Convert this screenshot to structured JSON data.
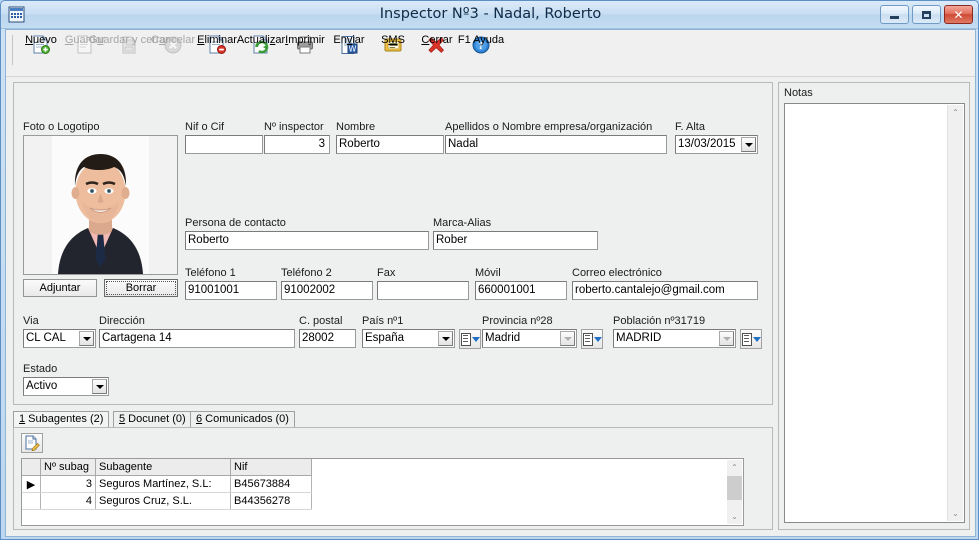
{
  "window": {
    "title": "Inspector Nº3 - Nadal, Roberto",
    "icon": "application-icon",
    "minimize": "minimize-button",
    "maximize": "maximize-button",
    "close": "close-button"
  },
  "toolbar": {
    "items": [
      {
        "label": "Nuevo",
        "accel": "N",
        "icon": "new-document-icon",
        "disabled": false
      },
      {
        "label": "Guardar",
        "accel": "G",
        "icon": "save-document-icon",
        "disabled": true
      },
      {
        "label": "Guardar y cerrar",
        "accel": "u",
        "icon": "save-and-close-icon",
        "disabled": true
      },
      {
        "label": "Cancelar",
        "accel": "a",
        "icon": "cancel-icon",
        "disabled": true
      },
      {
        "label": "Eliminar",
        "accel": "E",
        "icon": "delete-document-icon",
        "disabled": false
      },
      {
        "label": "Actualizar",
        "accel": "z",
        "icon": "refresh-icon",
        "disabled": false
      },
      {
        "label": "Imprimir",
        "accel": "I",
        "icon": "printer-icon",
        "disabled": false
      },
      {
        "label": "Enviar",
        "accel": "v",
        "icon": "send-word-icon",
        "disabled": false
      },
      {
        "label": "SMS",
        "accel": "M",
        "icon": "sms-icon",
        "disabled": false
      },
      {
        "label": "Cerrar",
        "accel": "C",
        "icon": "close-cross-icon",
        "disabled": false
      },
      {
        "label": "F1 Ayuda",
        "accel": "",
        "icon": "help-icon",
        "disabled": false
      }
    ]
  },
  "form": {
    "photo_label": "Foto o Logotipo",
    "attach_button": "Adjuntar",
    "delete_button": "Borrar",
    "nif_label": "Nif o Cif",
    "nif_value": "",
    "inspector_num_label": "Nº inspector",
    "inspector_num_value": "3",
    "nombre_label": "Nombre",
    "nombre_value": "Roberto",
    "apellidos_label": "Apellidos o Nombre empresa/organización",
    "apellidos_value": "Nadal",
    "falta_label": "F. Alta",
    "falta_value": "13/03/2015",
    "contacto_label": "Persona de contacto",
    "contacto_value": "Roberto",
    "marca_label": "Marca-Alias",
    "marca_value": "Rober",
    "tel1_label": "Teléfono 1",
    "tel1_value": "91001001",
    "tel2_label": "Teléfono 2",
    "tel2_value": "91002002",
    "fax_label": "Fax",
    "fax_value": "",
    "movil_label": "Móvil",
    "movil_value": "660001001",
    "email_label": "Correo electrónico",
    "email_value": "roberto.cantalejo@gmail.com",
    "via_label": "Via",
    "via_value": "CL CAL",
    "direccion_label": "Dirección",
    "direccion_value": "Cartagena 14",
    "cpostal_label": "C. postal",
    "cpostal_value": "28002",
    "pais_label": "País nº1",
    "pais_value": "España",
    "provincia_label": "Provincia nº28",
    "provincia_value": "Madrid",
    "poblacion_label": "Población nº31719",
    "poblacion_value": "MADRID",
    "estado_label": "Estado",
    "estado_value": "Activo"
  },
  "notes": {
    "label": "Notas",
    "value": ""
  },
  "tabs": [
    {
      "accel": "1",
      "label": " Subagentes (2)",
      "active": true
    },
    {
      "accel": "5",
      "label": " Docunet (0)",
      "active": false
    },
    {
      "accel": "6",
      "label": " Comunicados (0)",
      "active": false
    }
  ],
  "subagents_grid": {
    "edit_button": "edit-record-icon",
    "columns": [
      "",
      "Nº subag",
      "Subagente",
      "Nif"
    ],
    "rows": [
      {
        "marker": "▶",
        "num": "3",
        "name": "Seguros Martínez, S.L:",
        "nif": "B45673884"
      },
      {
        "marker": "",
        "num": "4",
        "name": "Seguros Cruz, S.L.",
        "nif": "B44356278"
      }
    ]
  }
}
